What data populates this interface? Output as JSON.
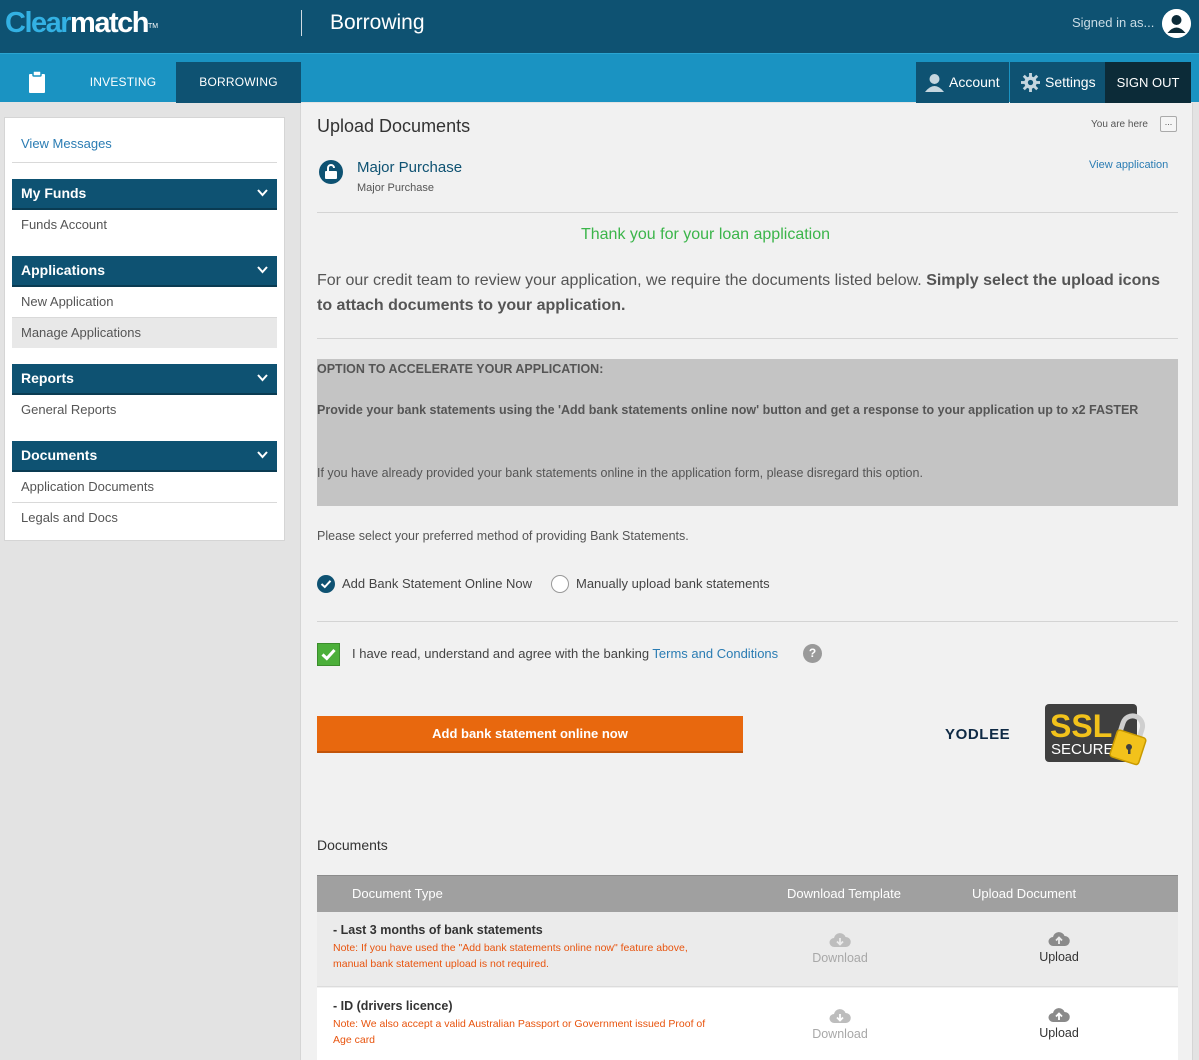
{
  "brand": {
    "logo_part1": "Clear",
    "logo_part2": "match",
    "logo_tm": "TM"
  },
  "header": {
    "page_title": "Borrowing",
    "signed_in_text": "Signed in as..."
  },
  "nav": {
    "investing": "INVESTING",
    "borrowing": "BORROWING",
    "account": "Account",
    "settings": "Settings",
    "sign_out": "SIGN OUT"
  },
  "sidebar": {
    "view_messages": "View Messages",
    "groups": [
      {
        "title": "My Funds",
        "items": [
          "Funds Account"
        ]
      },
      {
        "title": "Applications",
        "items": [
          "New Application",
          "Manage Applications"
        ]
      },
      {
        "title": "Reports",
        "items": [
          "General Reports"
        ]
      },
      {
        "title": "Documents",
        "items": [
          "Application Documents",
          "Legals and Docs"
        ]
      }
    ],
    "active_item": "Manage Applications"
  },
  "main": {
    "title": "Upload Documents",
    "you_are_here": "You are here",
    "dots": "...",
    "application": {
      "name": "Major Purchase",
      "subtitle": "Major Purchase",
      "view_link": "View application"
    },
    "thanks": "Thank you for your loan application",
    "intro_plain": "For our credit team to review your application, we require the documents listed below. ",
    "intro_bold": "Simply select the upload icons to attach documents to your application.",
    "accelerate": {
      "heading": "OPTION TO ACCELERATE YOUR APPLICATION:",
      "body": "Provide your bank statements using the 'Add bank statements online now' button and get a response to your application up to x2 FASTER",
      "note": "If you have already provided your bank statements online in the application form, please disregard this option."
    },
    "preferred_method": "Please select your preferred method of providing Bank Statements.",
    "radio_online": "Add Bank Statement Online Now",
    "radio_manual": "Manually upload bank statements",
    "agree_text": "I have read, understand and agree with the banking ",
    "terms_link": "Terms and Conditions",
    "help": "?",
    "add_button": "Add bank statement online now",
    "yodlee": "YODLEE",
    "ssl_line1": "SSL",
    "ssl_line2": "SECURE",
    "documents_label": "Documents"
  },
  "table": {
    "headers": {
      "type": "Document Type",
      "template": "Download Template",
      "upload": "Upload Document"
    },
    "rows": [
      {
        "name": "- Last 3 months of bank statements",
        "note": "Note: If you have used the \"Add bank statements online now\" feature above, manual bank statement upload is not required.",
        "download": "Download",
        "upload": "Upload"
      },
      {
        "name": "- ID (drivers licence)",
        "note": "Note: We also accept a valid Australian Passport or Government issued Proof of Age card",
        "download": "Download",
        "upload": "Upload"
      }
    ]
  },
  "colors": {
    "dark_blue": "#0e5272",
    "nav_blue": "#1a93c2",
    "orange": "#e8680e",
    "green": "#3bb54a",
    "note_orange": "#e8540e"
  }
}
